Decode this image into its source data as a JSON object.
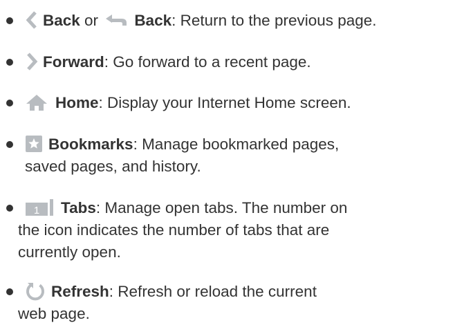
{
  "items": [
    {
      "icon": "chevron-left-icon",
      "term": "Back",
      "connector": " or ",
      "term2_icon": "back-arrow-icon",
      "term2": "Back",
      "desc": ": Return to the previous page."
    },
    {
      "icon": "chevron-right-icon",
      "term": "Forward",
      "desc": ": Go forward to a recent page."
    },
    {
      "icon": "home-icon",
      "term": "Home",
      "desc": ": Display your Internet Home screen."
    },
    {
      "icon": "bookmark-star-icon",
      "term": "Bookmarks",
      "desc": ": Manage bookmarked pages,",
      "cont": [
        "saved pages, and history."
      ]
    },
    {
      "icon": "tabs-icon",
      "icon_text": "1",
      "term": "Tabs",
      "desc": ": Manage open tabs. The number on",
      "cont": [
        "the icon indicates the number of tabs that are",
        "currently open."
      ]
    },
    {
      "icon": "refresh-icon",
      "term": "Refresh",
      "desc": ": Refresh or reload the current",
      "cont": [
        "web page."
      ]
    }
  ],
  "colors": {
    "text": "#333333",
    "icon": "#b8bcc0",
    "icon_dark": "#9ea3a8"
  }
}
